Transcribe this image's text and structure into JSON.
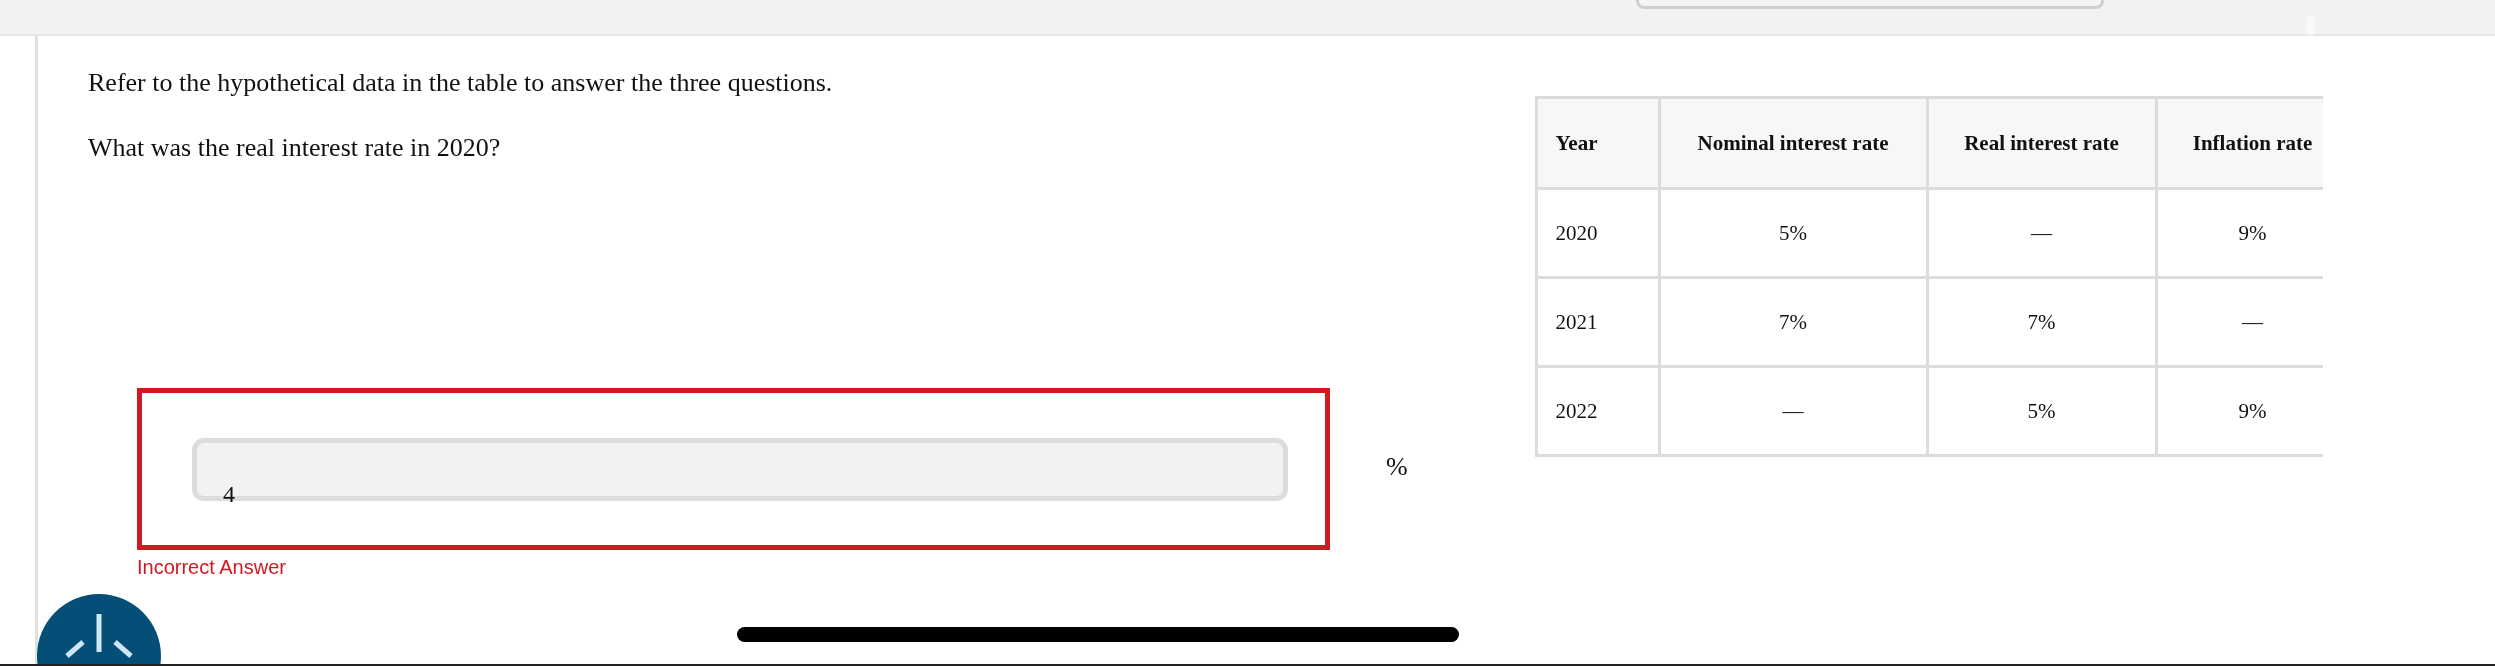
{
  "intro": "Refer to the hypothetical data in the table to answer the three questions.",
  "question": "What was the real interest rate in 2020?",
  "table": {
    "columns": [
      "Year",
      "Nominal interest rate",
      "Real interest rate",
      "Inflation rate"
    ],
    "rows": [
      [
        "2020",
        "5%",
        "—",
        "9%"
      ],
      [
        "2021",
        "7%",
        "7%",
        "—"
      ],
      [
        "2022",
        "—",
        "5%",
        "9%"
      ]
    ]
  },
  "answer": {
    "value": "4",
    "unit": "%",
    "correct": false,
    "feedback": "Incorrect Answer"
  }
}
